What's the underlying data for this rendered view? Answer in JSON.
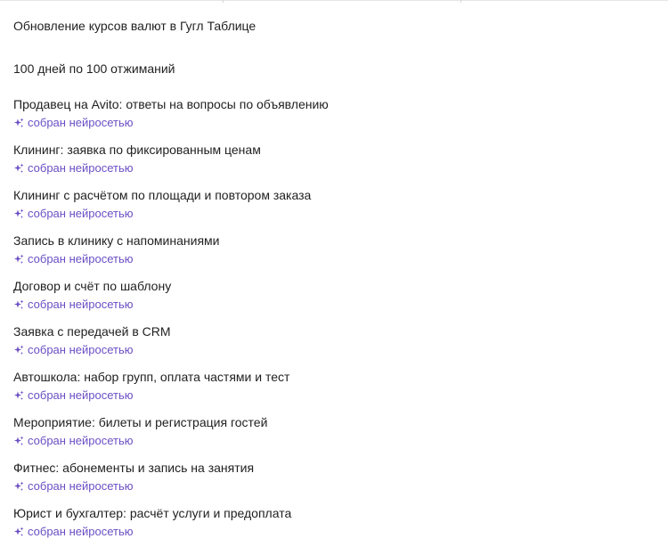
{
  "accent_color": "#6b4fc4",
  "items": [
    {
      "title": "Обновление курсов валют в Гугл Таблице",
      "badge": ""
    },
    {
      "title": "100 дней по 100 отжиманий",
      "badge": ""
    },
    {
      "title": "Продавец на Avito: ответы на вопросы по объявлению",
      "badge": "собран нейросетью",
      "badge_icon": "sparkle-icon"
    },
    {
      "title": "Клининг: заявка по фиксированным ценам",
      "badge": "собран нейросетью",
      "badge_icon": "sparkle-icon"
    },
    {
      "title": "Клининг с расчётом по площади и повтором заказа",
      "badge": "собран нейросетью",
      "badge_icon": "sparkle-icon"
    },
    {
      "title": "Запись в клинику с напоминаниями",
      "badge": "собран нейросетью",
      "badge_icon": "sparkle-icon"
    },
    {
      "title": "Договор и счёт по шаблону",
      "badge": "собран нейросетью",
      "badge_icon": "sparkle-icon"
    },
    {
      "title": "Заявка с передачей в CRM",
      "badge": "собран нейросетью",
      "badge_icon": "sparkle-icon"
    },
    {
      "title": "Автошкола: набор групп, оплата частями и тест",
      "badge": "собран нейросетью",
      "badge_icon": "sparkle-icon"
    },
    {
      "title": "Мероприятие: билеты и регистрация гостей",
      "badge": "собран нейросетью",
      "badge_icon": "sparkle-icon"
    },
    {
      "title": "Фитнес: абонементы и запись на занятия",
      "badge": "собран нейросетью",
      "badge_icon": "sparkle-icon"
    },
    {
      "title": "Юрист и бухгалтер: расчёт услуги и предоплата",
      "badge": "собран нейросетью",
      "badge_icon": "sparkle-icon"
    }
  ]
}
